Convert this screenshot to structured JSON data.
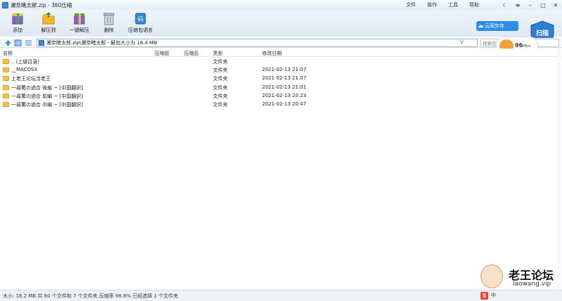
{
  "window": {
    "title": "瀬奈睹太郎.zip - 360压缩",
    "menu": [
      "文件",
      "操作",
      "工具",
      "帮助"
    ]
  },
  "toolbar": {
    "buttons": [
      {
        "label": "添加",
        "icon": "add-archive-icon"
      },
      {
        "label": "解压到",
        "icon": "extract-to-icon"
      },
      {
        "label": "一键解压",
        "icon": "one-click-extract-icon"
      },
      {
        "label": "删除",
        "icon": "trash-icon"
      },
      {
        "label": "压缩包语言",
        "icon": "language-icon"
      }
    ],
    "cloud_label": "云同步存",
    "shield_label": "扫描"
  },
  "pathbar": {
    "path": "瀬奈睹太郎.zip\\瀬奈睹太郎 - 解包大小为 16.4 MB",
    "v_label": "V",
    "search_placeholder": "搜索压缩包中的文件"
  },
  "speed": {
    "value": "96",
    "unit": "KB/s"
  },
  "columns": {
    "name": "名称",
    "packed": "压缩前",
    "after": "压缩后",
    "type": "类型",
    "modified": "修改日期"
  },
  "rows": [
    {
      "name": ".. (上级目录)",
      "type": "文件夹",
      "modified": ""
    },
    {
      "name": "__MACOSX",
      "type": "文件夹",
      "modified": "2021-02-13 21:07"
    },
    {
      "name": "上老王论坛当老王",
      "type": "文件夹",
      "modified": "2021-02-13 21:07"
    },
    {
      "name": "一尋驚の過合 後編 ~ [中国翻訳]",
      "type": "文件夹",
      "modified": "2021-02-13 21:01"
    },
    {
      "name": "一尋驚の過合 前編 ~ [中国翻訳]",
      "type": "文件夹",
      "modified": "2021-02-13 20:23"
    },
    {
      "name": "一尋驚の過合 中編 ~ [中国翻訳]",
      "type": "文件夹",
      "modified": "2021-02-13 20:47"
    }
  ],
  "status": {
    "text": "大小: 16.2 MB 共 80 个文件和 7 个文件夹 压缩率 98.8% 已经选择 1 个文件夹"
  },
  "watermark": {
    "title": "老王论坛",
    "url": "laowang.vip"
  },
  "tray": {
    "ime": "S",
    "label": "中"
  }
}
